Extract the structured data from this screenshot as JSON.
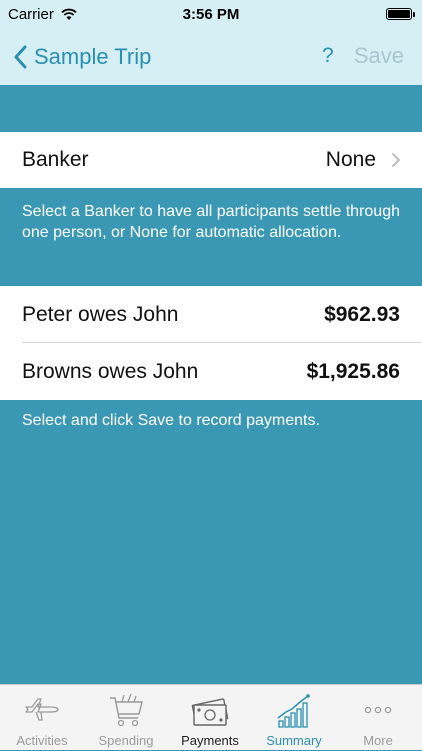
{
  "status_bar": {
    "carrier": "Carrier",
    "time": "3:56 PM"
  },
  "nav": {
    "back_label": "Sample Trip",
    "help_label": "?",
    "save_label": "Save"
  },
  "banker": {
    "label": "Banker",
    "value": "None"
  },
  "banker_note": "Select a Banker to have all participants settle through one person, or None for automatic allocation.",
  "payments": [
    {
      "label": "Peter owes John",
      "amount": "$962.93"
    },
    {
      "label": "Browns owes John",
      "amount": "$1,925.86"
    }
  ],
  "payments_note": "Select and click Save to record payments.",
  "tabs": [
    {
      "label": "Activities",
      "icon": "airplane-icon"
    },
    {
      "label": "Spending",
      "icon": "shopping-cart-icon"
    },
    {
      "label": "Payments",
      "icon": "money-icon"
    },
    {
      "label": "Summary",
      "icon": "bar-chart-icon"
    },
    {
      "label": "More",
      "icon": "more-dots-icon"
    }
  ],
  "colors": {
    "accent": "#2a8fb0",
    "background": "#3a98b4",
    "navbar": "#d6eff5"
  }
}
